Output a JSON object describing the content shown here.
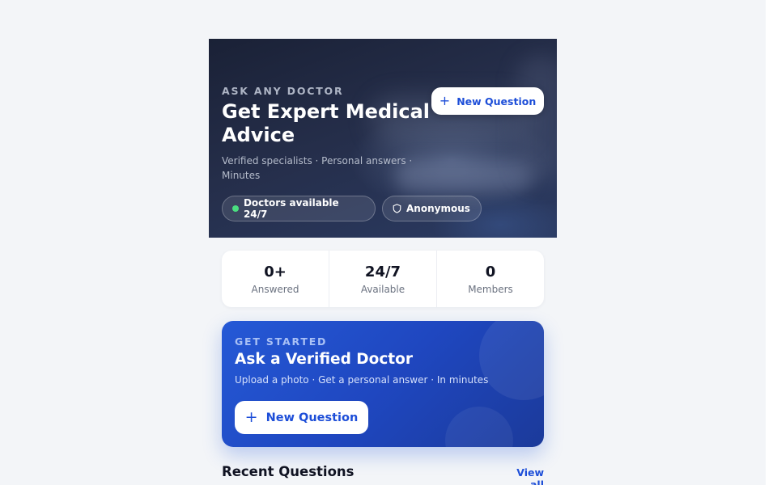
{
  "hero": {
    "eyebrow": "ASK ANY DOCTOR",
    "title": "Get Expert Medical Advice",
    "subtitle": "Verified specialists · Personal answers · Minutes",
    "new_question_label": "New Question",
    "badges": [
      {
        "label": "Doctors available 24/7",
        "icon": "green-dot",
        "color": "#4ade80"
      },
      {
        "label": "Anonymous",
        "icon": "shield-icon"
      }
    ]
  },
  "stats": [
    {
      "value": "0+",
      "label": "Answered"
    },
    {
      "value": "24/7",
      "label": "Available"
    },
    {
      "value": "0",
      "label": "Members"
    }
  ],
  "cta": {
    "eyebrow": "GET STARTED",
    "title": "Ask a Verified Doctor",
    "subtitle": "Upload a photo · Get a personal answer · In minutes",
    "button_label": "New Question"
  },
  "recent": {
    "title": "Recent Questions",
    "view_all_label": "View all"
  },
  "colors": {
    "accent": "#1d4ed8",
    "cta_background": "#2559d6",
    "page_background": "#f3f5f8"
  }
}
